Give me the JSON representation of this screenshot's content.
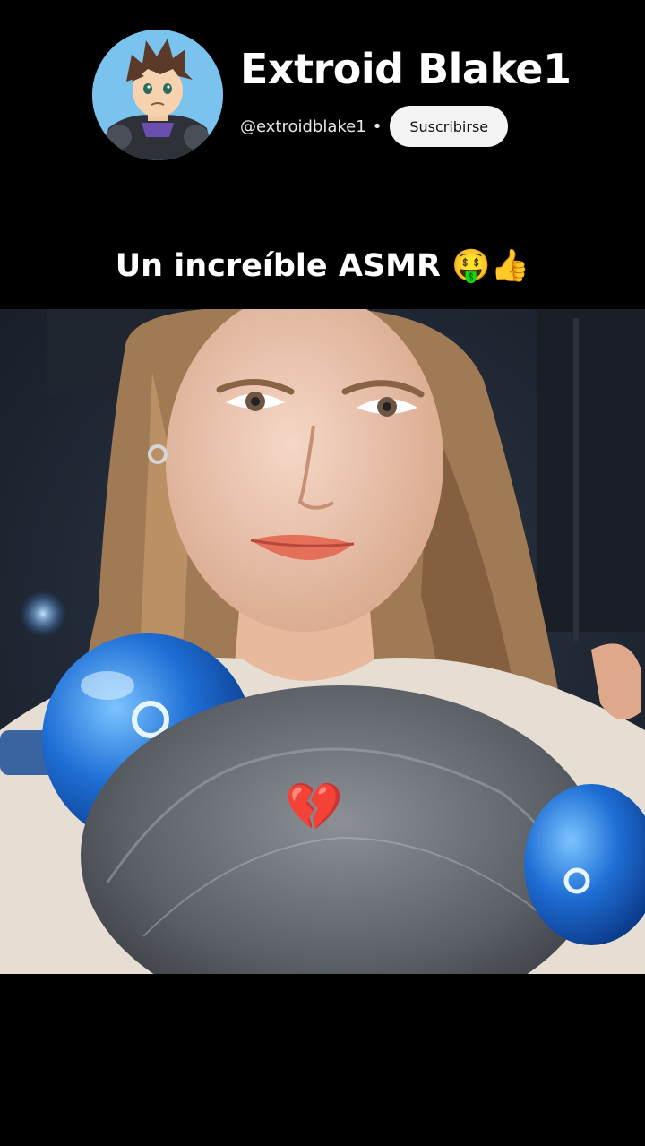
{
  "channel": {
    "name": "Extroid Blake1",
    "handle": "@extroidblake1",
    "separator": "•",
    "subscribe_label": "Suscribirse",
    "avatar_icon": "cartoon-character-avatar"
  },
  "video": {
    "caption": "Un increíble ASMR 🤑👍",
    "overlay_emoji": "💔",
    "scene": "asmr-video-frame"
  },
  "colors": {
    "background": "#000000",
    "subscribe_bg": "#f4f4f4",
    "subscribe_text": "#111111"
  }
}
